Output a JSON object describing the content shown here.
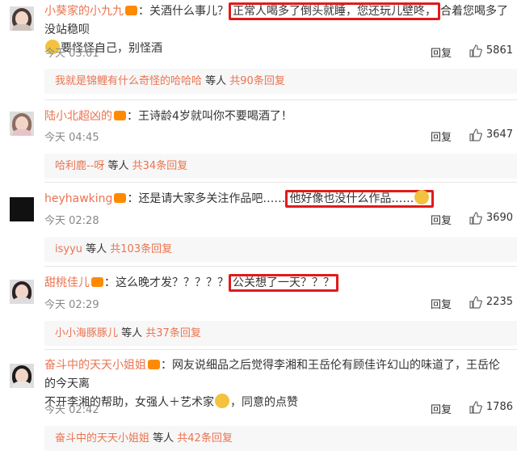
{
  "comments": [
    {
      "user": "小葵家的小九九",
      "text_a": "：关酒什么事儿？",
      "highlight": "正常人喝多了倒头就睡，您还玩儿壁咚，",
      "text_b": "合着您喝多了没站稳呗",
      "text_c": "要怪怪自己，别怪酒",
      "time": "今天 03:01",
      "reply": "回复",
      "likes": "5861",
      "sub_name": "我就是锦鲤有什么奇怪的哈哈哈",
      "sub_mid": " 等人 ",
      "sub_count": "共90条回复"
    },
    {
      "user": "陆小北超凶的",
      "text_a": "：王诗龄4岁就叫你不要喝酒了！",
      "time": "今天 04:45",
      "reply": "回复",
      "likes": "3647",
      "sub_name": "哈利鹿--呀",
      "sub_mid": " 等人 ",
      "sub_count": "共34条回复"
    },
    {
      "user": "heyhawking",
      "text_a": "：还是请大家多关注作品吧……",
      "highlight": "他好像也没什么作品……",
      "time": "今天 02:28",
      "reply": "回复",
      "likes": "3690",
      "sub_name": "isyyu",
      "sub_mid": " 等人 ",
      "sub_count": "共103条回复"
    },
    {
      "user": "甜桃佳儿",
      "text_a": "：这么晚才发？？？？？",
      "highlight": "公关想了一天？？？",
      "time": "今天 02:29",
      "reply": "回复",
      "likes": "2235",
      "sub_name": "小小海豚豚儿",
      "sub_mid": " 等人 ",
      "sub_count": "共37条回复"
    },
    {
      "user": "奋斗中的天天小姐姐",
      "text_a": "：网友说细品之后觉得李湘和王岳伦有顾佳许幻山的味道了，王岳伦的今天离",
      "text_b": "不开李湘的帮助，女强人＋艺术家",
      "text_c": "，同意的点赞",
      "time": "今天 02:42",
      "reply": "回复",
      "likes": "1786",
      "sub_name": "奋斗中的天天小姐姐",
      "sub_mid": " 等人 ",
      "sub_count": "共42条回复"
    }
  ]
}
